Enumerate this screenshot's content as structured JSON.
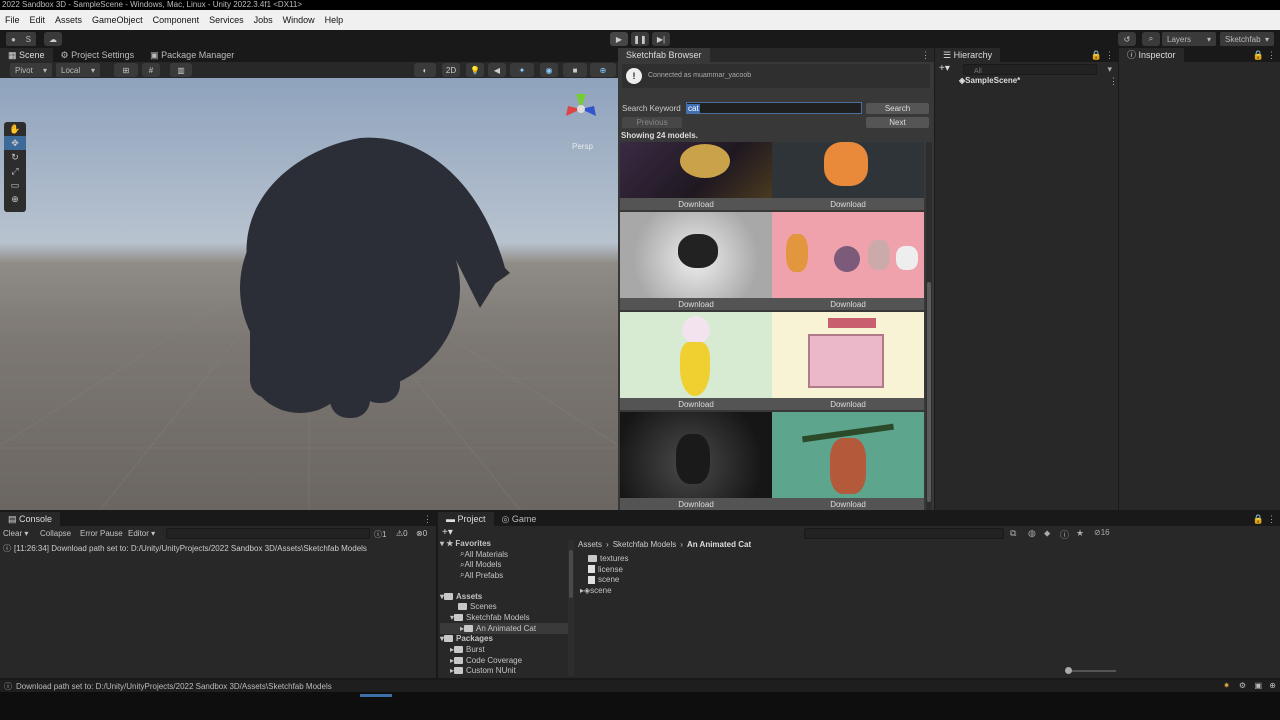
{
  "window": {
    "title": "2022 Sandbox 3D - SampleScene - Windows, Mac, Linux - Unity 2022.3.4f1 <DX11>"
  },
  "menu": [
    "File",
    "Edit",
    "Assets",
    "GameObject",
    "Component",
    "Services",
    "Jobs",
    "Window",
    "Help"
  ],
  "toolbar": {
    "account": "S",
    "layers": "Layers",
    "layout": "Sketchfab"
  },
  "scene": {
    "tabs": [
      "Scene",
      "Project Settings",
      "Package Manager"
    ],
    "pivot": "Pivot",
    "local": "Local",
    "mode_2d": "2D",
    "gizmo_label": "Persp"
  },
  "sketchfab": {
    "tab": "Sketchfab Browser",
    "connected": "Connected as muammar_yacoob",
    "search_label": "Search Keyword",
    "search_value": "cat",
    "search_button": "Search",
    "previous_button": "Previous",
    "next_button": "Next",
    "results_text": "Showing 24 models.",
    "download_label": "Download"
  },
  "hierarchy": {
    "tab": "Hierarchy",
    "search_placeholder": "All",
    "scene_item": "SampleScene*"
  },
  "inspector": {
    "tab": "Inspector"
  },
  "console": {
    "tab": "Console",
    "clear": "Clear",
    "collapse": "Collapse",
    "error_pause": "Error Pause",
    "editor": "Editor",
    "count_log": "1",
    "count_warn": "0",
    "count_error": "0",
    "message": "[11:26:34] Download path set to: D:/Unity/UnityProjects/2022 Sandbox 3D/Assets\\Sketchfab Models"
  },
  "project": {
    "tabs": [
      "Project",
      "Game"
    ],
    "hidden_count": "16",
    "favorites_label": "Favorites",
    "favorites": [
      "All Materials",
      "All Models",
      "All Prefabs"
    ],
    "assets_label": "Assets",
    "assets": [
      "Scenes",
      "Sketchfab Models"
    ],
    "selected_folder": "An Animated Cat",
    "packages_label": "Packages",
    "packages": [
      "Burst",
      "Code Coverage",
      "Custom NUnit"
    ],
    "breadcrumb": [
      "Assets",
      "Sketchfab Models",
      "An Animated Cat"
    ],
    "files": [
      "textures",
      "license",
      "scene",
      "scene"
    ]
  },
  "status": {
    "message": "Download path set to: D:/Unity/UnityProjects/2022 Sandbox 3D/Assets\\Sketchfab Models"
  }
}
